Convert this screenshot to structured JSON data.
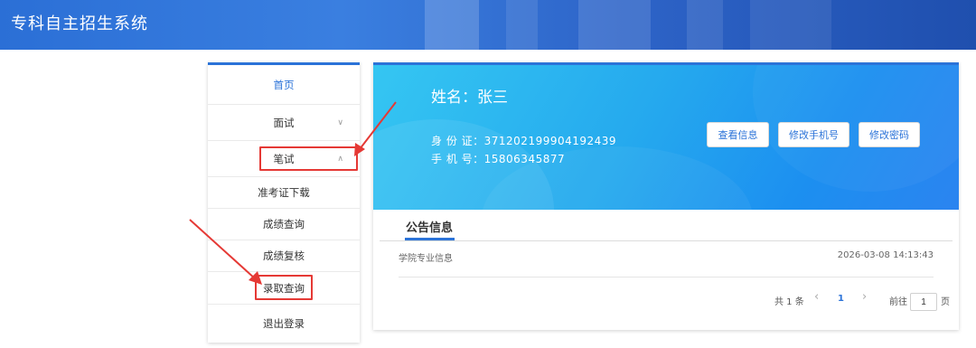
{
  "header": {
    "title": "专科自主招生系统"
  },
  "sidebar": {
    "items": [
      {
        "label": "首页"
      },
      {
        "label": "面试",
        "chevron": "∨"
      },
      {
        "label": "笔试",
        "chevron": "∧"
      },
      {
        "label": "准考证下载"
      },
      {
        "label": "成绩查询"
      },
      {
        "label": "成绩复核"
      },
      {
        "label": "录取查询"
      },
      {
        "label": "退出登录"
      }
    ]
  },
  "profile": {
    "name_label": "姓名：张三",
    "id_line": "身 份 证：371202199904192439",
    "phone_line": "手 机 号：15806345877"
  },
  "actions": {
    "view_info": "查看信息",
    "change_phone": "修改手机号",
    "change_password": "修改密码"
  },
  "notice": {
    "tab_label": "公告信息",
    "items": [
      {
        "title": "学院专业信息",
        "time": "2026-03-08 14:13:43"
      }
    ]
  },
  "pagination": {
    "total": "共 1 条",
    "prev": "‹",
    "current": "1",
    "next": "›",
    "goto_label": "前往",
    "goto_value": "1",
    "page_suffix": "页"
  },
  "colors": {
    "accent": "#2b73d8",
    "highlight": "#e53935"
  }
}
